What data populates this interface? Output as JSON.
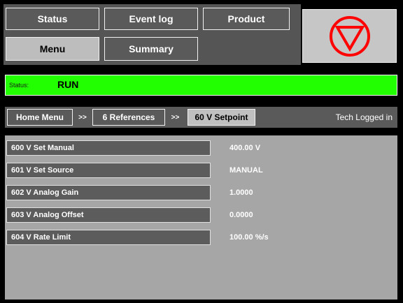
{
  "nav": {
    "status": "Status",
    "event_log": "Event log",
    "product": "Product",
    "menu": "Menu",
    "summary": "Summary"
  },
  "stop_icon_color": "#ff0000",
  "status_bar": {
    "label": "Status:",
    "value": "RUN",
    "color": "#22ff00"
  },
  "breadcrumb": {
    "items": [
      "Home Menu",
      "6 References",
      "60 V Setpoint"
    ],
    "separator": ">>",
    "user_status": "Tech Logged in"
  },
  "parameters": [
    {
      "label": "600 V Set Manual",
      "value": "400.00 V"
    },
    {
      "label": "601 V Set Source",
      "value": "MANUAL"
    },
    {
      "label": "602 V Analog Gain",
      "value": "1.0000"
    },
    {
      "label": "603 V Analog Offset",
      "value": "0.0000"
    },
    {
      "label": "604 V Rate Limit",
      "value": "100.00 %/s"
    }
  ]
}
